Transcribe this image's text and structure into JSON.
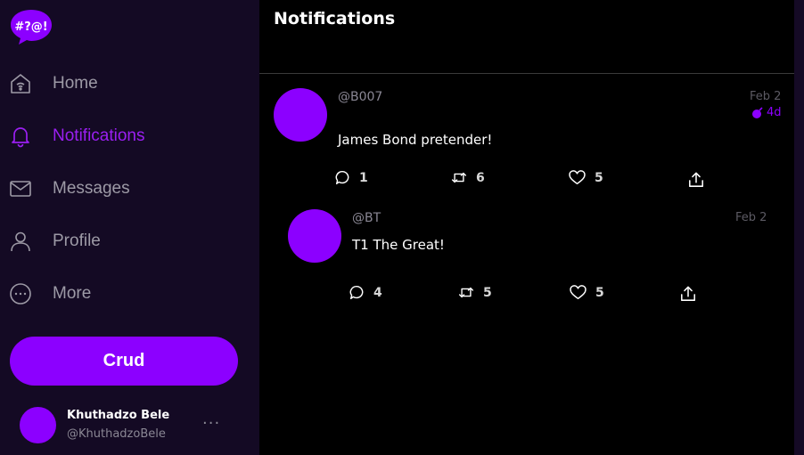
{
  "app": {
    "logo_text": "#?@!",
    "brand_color": "#8c00ff"
  },
  "sidebar": {
    "items": [
      {
        "id": "home",
        "label": "Home",
        "icon": "home-wifi-icon"
      },
      {
        "id": "notifications",
        "label": "Notifications",
        "icon": "bell-icon",
        "active": true
      },
      {
        "id": "messages",
        "label": "Messages",
        "icon": "envelope-icon"
      },
      {
        "id": "profile",
        "label": "Profile",
        "icon": "person-icon"
      },
      {
        "id": "more",
        "label": "More",
        "icon": "more-circle-icon"
      }
    ],
    "crud_button": "Crud",
    "user": {
      "name": "Khuthadzo Bele",
      "handle": "@KhuthadzoBele",
      "menu": "···"
    }
  },
  "main": {
    "title": "Notifications",
    "posts": [
      {
        "handle": "@B007",
        "date": "Feb 2",
        "age": "4d",
        "text": "James Bond pretender!",
        "replies": "1",
        "retweets": "6",
        "likes": "5"
      },
      {
        "handle": "@BT",
        "date": "Feb 2",
        "text": "T1 The Great!",
        "replies": "4",
        "retweets": "5",
        "likes": "5"
      }
    ]
  }
}
